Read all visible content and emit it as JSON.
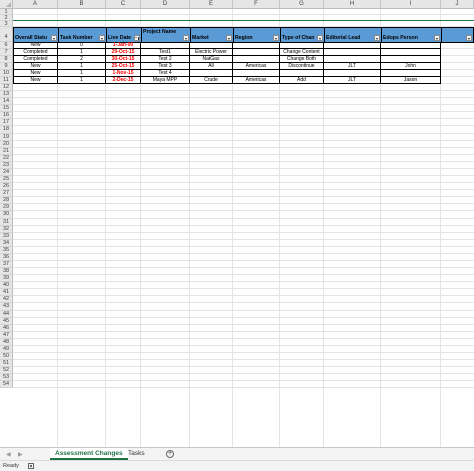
{
  "columns": [
    "A",
    "B",
    "C",
    "D",
    "E",
    "F",
    "G",
    "H",
    "I",
    "J"
  ],
  "rows": [
    "1",
    "2",
    "3",
    "4",
    "6",
    "7",
    "8",
    "9",
    "10",
    "11",
    "12",
    "13",
    "14",
    "15",
    "16",
    "17",
    "18",
    "19",
    "20",
    "21",
    "22",
    "23",
    "24",
    "25",
    "26",
    "27",
    "28",
    "29",
    "30",
    "31",
    "32",
    "33",
    "34",
    "35",
    "36",
    "37",
    "38",
    "39",
    "40",
    "41",
    "42",
    "43",
    "44",
    "45",
    "46",
    "47",
    "48",
    "49",
    "50",
    "51",
    "52",
    "53",
    "54"
  ],
  "table": {
    "headers": [
      "Overall Statu",
      "Task Number",
      "Live Date",
      "Project Name",
      "Market",
      "Region",
      "Type of Chan",
      "Editorial Lead",
      "Edops Person"
    ],
    "rows": [
      [
        "New",
        "0",
        "1-Jan-00",
        "",
        "",
        "",
        "",
        "",
        ""
      ],
      [
        "Completed",
        "1",
        "29-Oct-15",
        "Test1",
        "Electric Power",
        "",
        "Change Content",
        "",
        ""
      ],
      [
        "Completed",
        "2",
        "30-Oct-15",
        "Test 2",
        "NatGas",
        "",
        "Change Both",
        "",
        ""
      ],
      [
        "New",
        "1",
        "25-Oct-15",
        "Test 3",
        "All",
        "Americas",
        "Discontinue",
        "JLT",
        "John"
      ],
      [
        "New",
        "1",
        "1-Nov-15",
        "Test 4",
        "",
        "",
        "",
        "",
        ""
      ],
      [
        "New",
        "1",
        "2-Dec-15",
        "Maya MPP",
        "Crude",
        "Americas",
        "Add",
        "JLT",
        "Jason"
      ]
    ]
  },
  "sheet_tabs": [
    "Assessment Changes",
    "Tasks"
  ],
  "active_tab": "Assessment Changes",
  "add_sheet_label": "+",
  "status": "Ready",
  "colors": {
    "header_fill": "#5b9bd5",
    "date_text": "#ff0000",
    "excel_green": "#217346"
  },
  "icons": {
    "add_sheet": "plus-circle-icon",
    "filter": "filter-dropdown-icon",
    "macro": "macro-record-icon"
  }
}
